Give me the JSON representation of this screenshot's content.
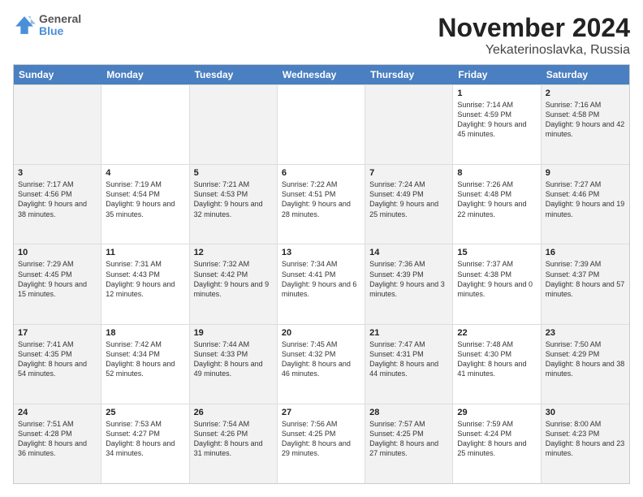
{
  "header": {
    "logo": {
      "general": "General",
      "blue": "Blue"
    },
    "title": "November 2024",
    "location": "Yekaterinoslavka, Russia"
  },
  "weekdays": [
    "Sunday",
    "Monday",
    "Tuesday",
    "Wednesday",
    "Thursday",
    "Friday",
    "Saturday"
  ],
  "rows": [
    [
      {
        "day": "",
        "info": ""
      },
      {
        "day": "",
        "info": ""
      },
      {
        "day": "",
        "info": ""
      },
      {
        "day": "",
        "info": ""
      },
      {
        "day": "",
        "info": ""
      },
      {
        "day": "1",
        "info": "Sunrise: 7:14 AM\nSunset: 4:59 PM\nDaylight: 9 hours and 45 minutes."
      },
      {
        "day": "2",
        "info": "Sunrise: 7:16 AM\nSunset: 4:58 PM\nDaylight: 9 hours and 42 minutes."
      }
    ],
    [
      {
        "day": "3",
        "info": "Sunrise: 7:17 AM\nSunset: 4:56 PM\nDaylight: 9 hours and 38 minutes."
      },
      {
        "day": "4",
        "info": "Sunrise: 7:19 AM\nSunset: 4:54 PM\nDaylight: 9 hours and 35 minutes."
      },
      {
        "day": "5",
        "info": "Sunrise: 7:21 AM\nSunset: 4:53 PM\nDaylight: 9 hours and 32 minutes."
      },
      {
        "day": "6",
        "info": "Sunrise: 7:22 AM\nSunset: 4:51 PM\nDaylight: 9 hours and 28 minutes."
      },
      {
        "day": "7",
        "info": "Sunrise: 7:24 AM\nSunset: 4:49 PM\nDaylight: 9 hours and 25 minutes."
      },
      {
        "day": "8",
        "info": "Sunrise: 7:26 AM\nSunset: 4:48 PM\nDaylight: 9 hours and 22 minutes."
      },
      {
        "day": "9",
        "info": "Sunrise: 7:27 AM\nSunset: 4:46 PM\nDaylight: 9 hours and 19 minutes."
      }
    ],
    [
      {
        "day": "10",
        "info": "Sunrise: 7:29 AM\nSunset: 4:45 PM\nDaylight: 9 hours and 15 minutes."
      },
      {
        "day": "11",
        "info": "Sunrise: 7:31 AM\nSunset: 4:43 PM\nDaylight: 9 hours and 12 minutes."
      },
      {
        "day": "12",
        "info": "Sunrise: 7:32 AM\nSunset: 4:42 PM\nDaylight: 9 hours and 9 minutes."
      },
      {
        "day": "13",
        "info": "Sunrise: 7:34 AM\nSunset: 4:41 PM\nDaylight: 9 hours and 6 minutes."
      },
      {
        "day": "14",
        "info": "Sunrise: 7:36 AM\nSunset: 4:39 PM\nDaylight: 9 hours and 3 minutes."
      },
      {
        "day": "15",
        "info": "Sunrise: 7:37 AM\nSunset: 4:38 PM\nDaylight: 9 hours and 0 minutes."
      },
      {
        "day": "16",
        "info": "Sunrise: 7:39 AM\nSunset: 4:37 PM\nDaylight: 8 hours and 57 minutes."
      }
    ],
    [
      {
        "day": "17",
        "info": "Sunrise: 7:41 AM\nSunset: 4:35 PM\nDaylight: 8 hours and 54 minutes."
      },
      {
        "day": "18",
        "info": "Sunrise: 7:42 AM\nSunset: 4:34 PM\nDaylight: 8 hours and 52 minutes."
      },
      {
        "day": "19",
        "info": "Sunrise: 7:44 AM\nSunset: 4:33 PM\nDaylight: 8 hours and 49 minutes."
      },
      {
        "day": "20",
        "info": "Sunrise: 7:45 AM\nSunset: 4:32 PM\nDaylight: 8 hours and 46 minutes."
      },
      {
        "day": "21",
        "info": "Sunrise: 7:47 AM\nSunset: 4:31 PM\nDaylight: 8 hours and 44 minutes."
      },
      {
        "day": "22",
        "info": "Sunrise: 7:48 AM\nSunset: 4:30 PM\nDaylight: 8 hours and 41 minutes."
      },
      {
        "day": "23",
        "info": "Sunrise: 7:50 AM\nSunset: 4:29 PM\nDaylight: 8 hours and 38 minutes."
      }
    ],
    [
      {
        "day": "24",
        "info": "Sunrise: 7:51 AM\nSunset: 4:28 PM\nDaylight: 8 hours and 36 minutes."
      },
      {
        "day": "25",
        "info": "Sunrise: 7:53 AM\nSunset: 4:27 PM\nDaylight: 8 hours and 34 minutes."
      },
      {
        "day": "26",
        "info": "Sunrise: 7:54 AM\nSunset: 4:26 PM\nDaylight: 8 hours and 31 minutes."
      },
      {
        "day": "27",
        "info": "Sunrise: 7:56 AM\nSunset: 4:25 PM\nDaylight: 8 hours and 29 minutes."
      },
      {
        "day": "28",
        "info": "Sunrise: 7:57 AM\nSunset: 4:25 PM\nDaylight: 8 hours and 27 minutes."
      },
      {
        "day": "29",
        "info": "Sunrise: 7:59 AM\nSunset: 4:24 PM\nDaylight: 8 hours and 25 minutes."
      },
      {
        "day": "30",
        "info": "Sunrise: 8:00 AM\nSunset: 4:23 PM\nDaylight: 8 hours and 23 minutes."
      }
    ]
  ]
}
